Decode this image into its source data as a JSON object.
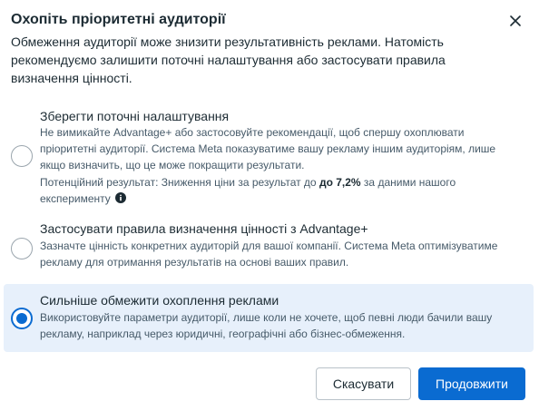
{
  "dialog": {
    "title": "Охопіть пріоритетні аудиторії",
    "intro": "Обмеження аудиторії може знизити результативність реклами. Натомість рекомендуємо залишити поточні налаштування або застосувати правила визначення цінності."
  },
  "options": [
    {
      "title": "Зберегти поточні налаштування",
      "description": "Не вимикайте Advantage+ або застосовуйте рекомендації, щоб спершу охоплювати пріоритетні аудиторії. Система Meta показуватиме вашу рекламу іншим аудиторіям, лише якщо визначить, що це може покращити результати.",
      "note_prefix": "Потенційний результат: Зниження ціни за результат до ",
      "note_bold": "до 7,2%",
      "note_suffix": " за даними нашого експерименту",
      "selected": false
    },
    {
      "title": "Застосувати правила визначення цінності з Advantage+",
      "description": "Зазначте цінність конкретних аудиторій для вашої компанії. Система Meta оптимізуватиме рекламу для отримання результатів на основі ваших правил.",
      "selected": false
    },
    {
      "title": "Сильніше обмежити охоплення реклами",
      "description": "Використовуйте параметри аудиторії, лише коли не хочете, щоб певні люди бачили вашу рекламу, наприклад через юридичні, географічні або бізнес-обмеження.",
      "selected": true
    }
  ],
  "buttons": {
    "cancel": "Скасувати",
    "continue": "Продовжити"
  },
  "colors": {
    "accent": "#0a6bd1",
    "selected_bg": "#e7f0fb"
  },
  "icons": {
    "close": "close-icon",
    "info": "info-icon"
  }
}
